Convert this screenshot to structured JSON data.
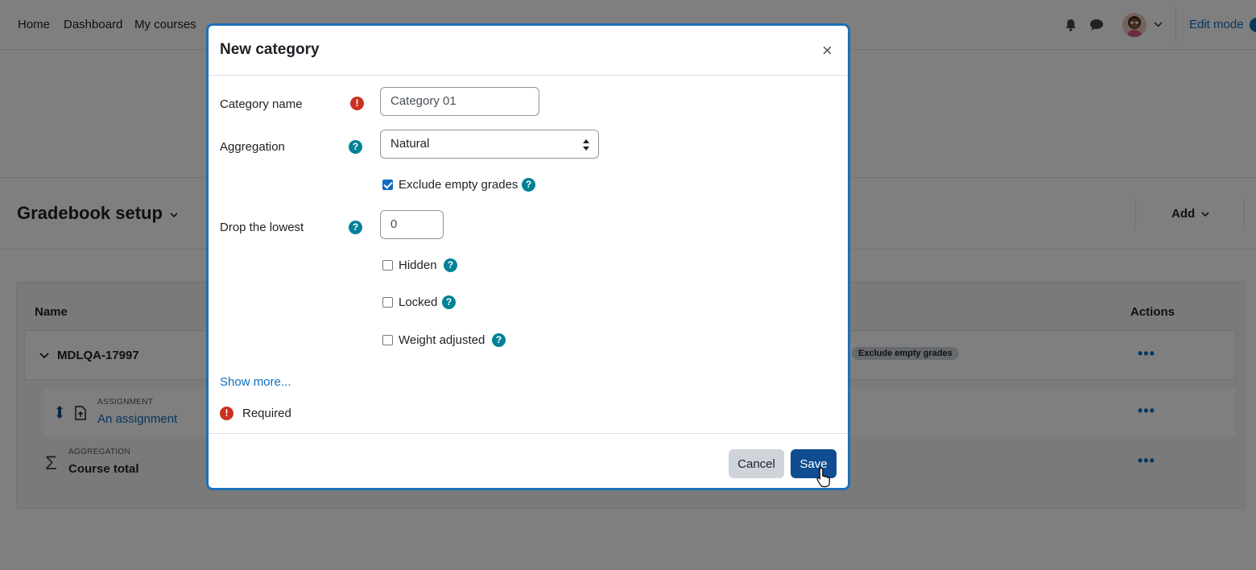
{
  "nav": {
    "home": "Home",
    "dashboard": "Dashboard",
    "my_courses": "My courses",
    "edit_mode": "Edit mode"
  },
  "page": {
    "title": "Gradebook setup",
    "add_label": "Add",
    "table": {
      "col_name": "Name",
      "col_actions": "Actions",
      "category": {
        "name": "MDLQA-17997",
        "badge": "Exclude empty grades"
      },
      "assignment": {
        "type": "ASSIGNMENT",
        "name": "An assignment"
      },
      "total": {
        "type": "AGGREGATION",
        "name": "Course total"
      }
    }
  },
  "modal": {
    "title": "New category",
    "fields": {
      "category_name": {
        "label": "Category name",
        "value": "Category 01"
      },
      "aggregation": {
        "label": "Aggregation",
        "value": "Natural"
      },
      "exclude_empty": {
        "label": "Exclude empty grades",
        "checked": true
      },
      "drop_lowest": {
        "label": "Drop the lowest",
        "value": "0"
      },
      "hidden": {
        "label": "Hidden",
        "checked": false
      },
      "locked": {
        "label": "Locked",
        "checked": false
      },
      "weight_adjusted": {
        "label": "Weight adjusted",
        "checked": false
      }
    },
    "show_more": "Show more...",
    "required": "Required",
    "cancel": "Cancel",
    "save": "Save"
  },
  "colors": {
    "primary": "#0f6cbf",
    "save_button": "#0f4c90",
    "help_icon": "#008196",
    "required_icon": "#ca3120"
  }
}
